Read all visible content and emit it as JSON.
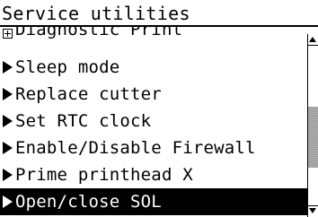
{
  "title": "Service utilities",
  "menu": {
    "items": [
      {
        "label": "Diagnostic Print",
        "icon": "expand-plus-icon",
        "partial": true,
        "selected": false
      },
      {
        "label": "Sleep mode",
        "icon": "triangle-right-icon",
        "selected": false
      },
      {
        "label": "Replace cutter",
        "icon": "triangle-right-icon",
        "selected": false
      },
      {
        "label": "Set RTC clock",
        "icon": "triangle-right-icon",
        "selected": false
      },
      {
        "label": "Enable/Disable Firewall",
        "icon": "triangle-right-icon",
        "selected": false
      },
      {
        "label": "Prime printhead X",
        "icon": "triangle-right-icon",
        "selected": false
      },
      {
        "label": "Open/close SOL",
        "icon": "triangle-right-icon",
        "selected": true
      }
    ]
  },
  "scrollbar": {
    "position_fraction": 0.62,
    "visible_fraction": 0.38
  },
  "colors": {
    "background": "#ffffff",
    "foreground": "#000000",
    "selection_background": "#000000",
    "selection_text": "#ffffff",
    "thumb_pattern": "#7a7a7a"
  }
}
